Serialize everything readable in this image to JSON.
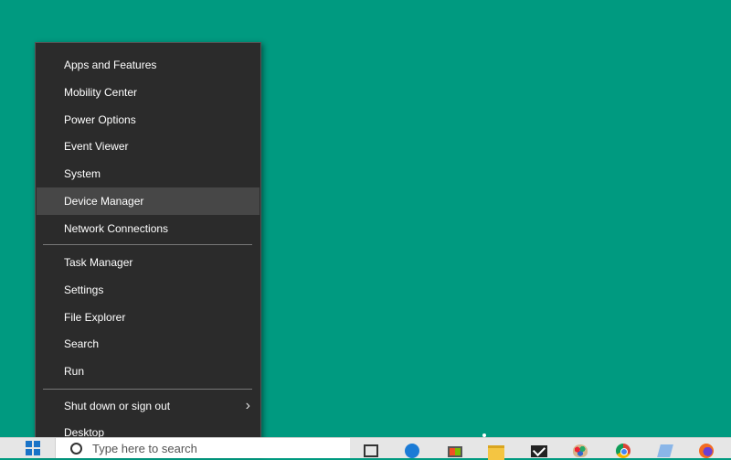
{
  "menu": {
    "items": [
      {
        "label": "Apps and Features"
      },
      {
        "label": "Mobility Center"
      },
      {
        "label": "Power Options"
      },
      {
        "label": "Event Viewer"
      },
      {
        "label": "System"
      },
      {
        "label": "Device Manager",
        "highlighted": true
      },
      {
        "label": "Network Connections"
      },
      {
        "label": "Task Manager"
      },
      {
        "label": "Settings"
      },
      {
        "label": "File Explorer"
      },
      {
        "label": "Search"
      },
      {
        "label": "Run"
      },
      {
        "label": "Shut down or sign out",
        "submenu": true
      },
      {
        "label": "Desktop"
      }
    ],
    "chevron_glyph": "›"
  },
  "taskbar": {
    "search_placeholder": "Type here to search",
    "pinned_icons": [
      "task-view-icon",
      "edge-icon",
      "store-icon",
      "file-explorer-icon",
      "mail-icon",
      "paint-icon",
      "chrome-icon",
      "notepad-icon",
      "firefox-icon"
    ]
  },
  "colors": {
    "desktop_background": "#009a80",
    "menu_background": "#2b2b2b",
    "menu_highlight": "#474747",
    "menu_text": "#ffffff"
  }
}
